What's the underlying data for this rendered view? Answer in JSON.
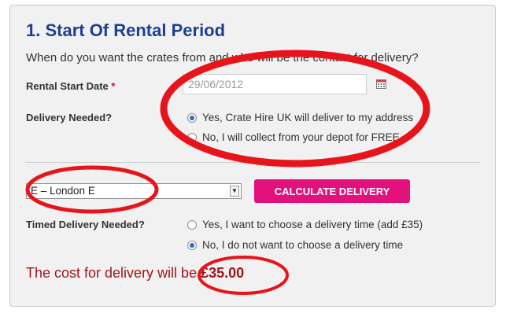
{
  "section": {
    "title": "1. Start Of Rental Period",
    "question": "When do you want the crates from and who will be the contact for delivery?"
  },
  "rental_start": {
    "label": "Rental Start Date",
    "required_mark": "*",
    "value": "29/06/2012",
    "icon": "calendar-icon"
  },
  "delivery_needed": {
    "label": "Delivery Needed?",
    "options": [
      {
        "label": "Yes, Crate Hire UK will deliver to my address",
        "checked": true
      },
      {
        "label": "No, I will collect from your depot for FREE",
        "checked": false
      }
    ]
  },
  "postcode_area": {
    "selected": "E – London E"
  },
  "calculate_button": {
    "label": "CALCULATE DELIVERY"
  },
  "timed_delivery": {
    "label": "Timed Delivery Needed?",
    "options": [
      {
        "label": "Yes, I want to choose a delivery time (add £35)",
        "checked": false
      },
      {
        "label": "No, I do not want to choose a delivery time",
        "checked": true
      }
    ]
  },
  "cost": {
    "text": "The cost for delivery will be",
    "amount": "£35.00"
  },
  "colors": {
    "title": "#1d3f93",
    "button": "#e2117c",
    "cost_text": "#a0151b",
    "annotation": "#e8141c",
    "radio_dot": "#2a6bcf"
  }
}
